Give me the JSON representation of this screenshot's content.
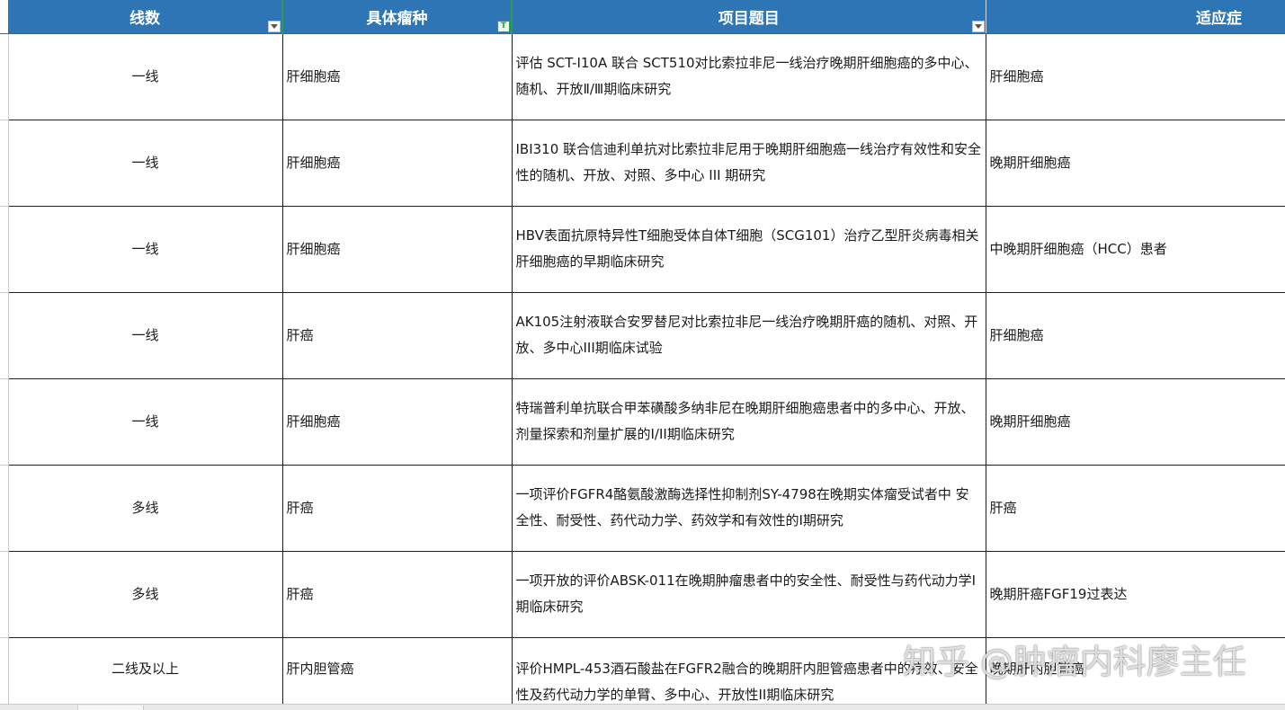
{
  "headers": [
    "线数",
    "具体瘤种",
    "项目题目",
    "适应症"
  ],
  "filter_active_label": "T",
  "rows": [
    {
      "line": "一线",
      "tumor": "肝细胞癌",
      "title": "评估 SCT-I10A 联合 SCT510对比索拉非尼一线治疗晚期肝细胞癌的多中心、随机、开放Ⅱ/Ⅲ期临床研究",
      "indication": "肝细胞癌"
    },
    {
      "line": "一线",
      "tumor": "肝细胞癌",
      "title": "IBI310 联合信迪利单抗对比索拉非尼用于晚期肝细胞癌一线治疗有效性和安全性的随机、开放、对照、多中心 III 期研究",
      "indication": "晚期肝细胞癌"
    },
    {
      "line": "一线",
      "tumor": "肝细胞癌",
      "title": "HBV表面抗原特异性T细胞受体自体T细胞（SCG101）治疗乙型肝炎病毒相关肝细胞癌的早期临床研究",
      "indication": "中晚期肝细胞癌（HCC）患者"
    },
    {
      "line": "一线",
      "tumor": "肝癌",
      "title": "AK105注射液联合安罗替尼对比索拉非尼一线治疗晚期肝癌的随机、对照、开放、多中心III期临床试验",
      "indication": "肝细胞癌"
    },
    {
      "line": "一线",
      "tumor": "肝细胞癌",
      "title": "特瑞普利单抗联合甲苯磺酸多纳非尼在晚期肝细胞癌患者中的多中心、开放、剂量探索和剂量扩展的I/II期临床研究",
      "indication": "晚期肝细胞癌"
    },
    {
      "line": "多线",
      "tumor": "肝癌",
      "title": "一项评价FGFR4酪氨酸激酶选择性抑制剂SY-4798在晚期实体瘤受试者中 安全性、耐受性、药代动力学、药效学和有效性的I期研究",
      "indication": "肝癌"
    },
    {
      "line": "多线",
      "tumor": "肝癌",
      "title": "一项开放的评价ABSK-011在晚期肿瘤患者中的安全性、耐受性与药代动力学I期临床研究",
      "indication": "晚期肝癌FGF19过表达"
    },
    {
      "line": "二线及以上",
      "tumor": "肝内胆管癌",
      "title": "评价HMPL-453酒石酸盐在FGFR2融合的晚期肝内胆管癌患者中的疗效、安全性及药代动力学的单臂、多中心、开放性II期临床研究",
      "indication": "晚期肝内胆管癌"
    }
  ],
  "watermark": "知乎 @肿瘤内科廖主任"
}
